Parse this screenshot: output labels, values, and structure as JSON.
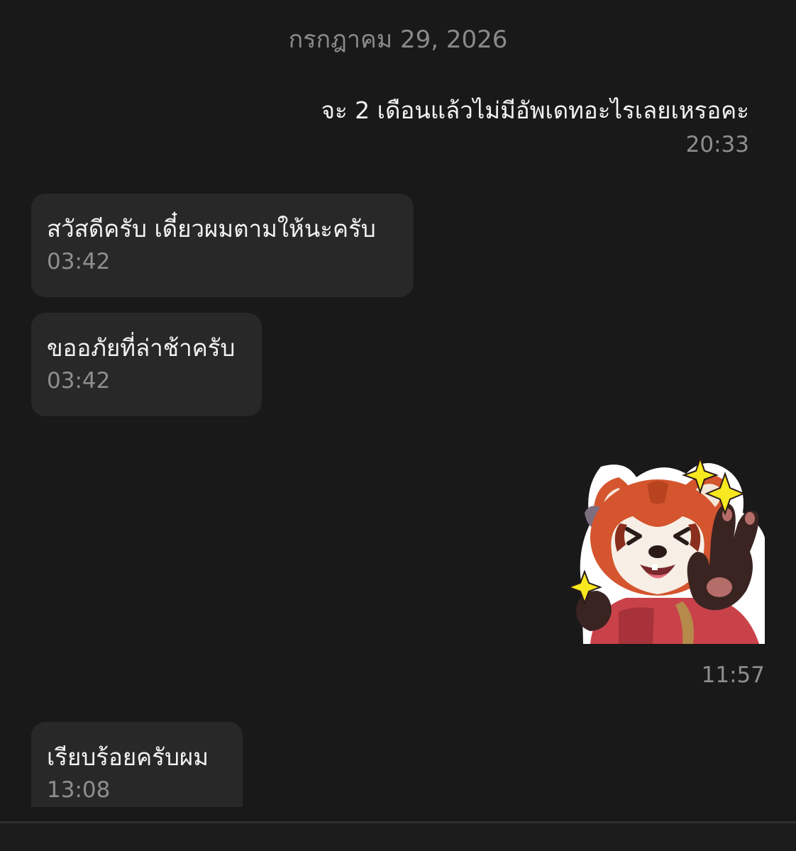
{
  "date_divider": "กรกฎาคม 29, 2026",
  "messages": [
    {
      "direction": "outgoing",
      "text": "จะ 2 เดือนแล้วไม่มีอัพเดทอะไรเลยเหรอคะ",
      "time": "20:33"
    },
    {
      "direction": "incoming",
      "text": "สวัสดีครับ เดี๋ยวผมตามให้นะครับ",
      "time": "03:42"
    },
    {
      "direction": "incoming",
      "text": "ขออภัยที่ล่าช้าครับ",
      "time": "03:42"
    },
    {
      "direction": "outgoing",
      "type": "sticker",
      "sticker": "red-panda-peace-sign-sticker",
      "time": "11:57"
    },
    {
      "direction": "incoming",
      "text": "เรียบร้อยครับผม",
      "time": "13:08"
    }
  ],
  "colors": {
    "background": "#191919",
    "bubble_incoming": "#282828",
    "text_primary": "#f2f2f2",
    "text_secondary": "#8e8e8e"
  }
}
